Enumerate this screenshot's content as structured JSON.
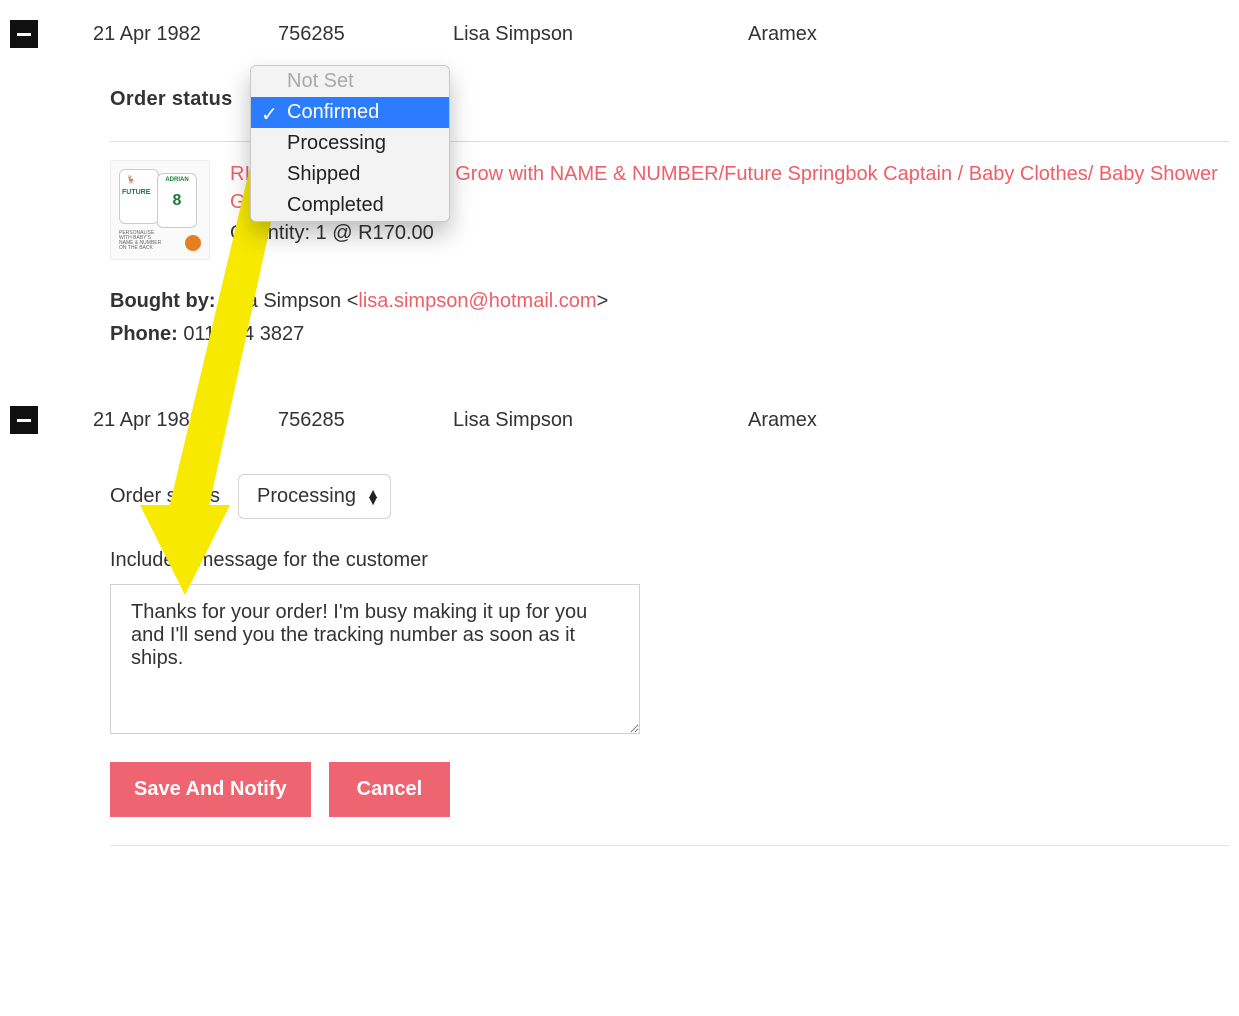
{
  "orders": [
    {
      "date": "21 Apr 1982",
      "order_number": "756285",
      "customer_name": "Lisa Simpson",
      "carrier": "Aramex"
    },
    {
      "date": "21 Apr 1982",
      "order_number": "756285",
      "customer_name": "Lisa Simpson",
      "carrier": "Aramex"
    }
  ],
  "status": {
    "label": "Order status",
    "options": [
      "Not Set",
      "Confirmed",
      "Processing",
      "Shipped",
      "Completed"
    ],
    "selected_top": "Confirmed",
    "selected_bottom": "Processing"
  },
  "item": {
    "title": "SPRINGBOK RUGBY Baby Grow with NAME & NUMBER/Future Springbok Captain / Baby Clothes/ Baby Shower Gift",
    "title_partial": "RINGBOK RUGBY Baby Grow with NAME & NUMBER/Future Springbok Captain / Baby Clothes/ Baby Shower Gift",
    "quantity_line": "Quantity: 1 @ R170.00",
    "thumb_name": "ADRIAN",
    "thumb_number": "8",
    "thumb_word": "FUTURE"
  },
  "buyer": {
    "label": "Bought by:",
    "name": "Lisa Simpson",
    "email": "lisa.simpson@hotmail.com",
    "phone_label": "Phone:",
    "phone": "011 214 3827"
  },
  "message": {
    "label": "Include a message for the customer",
    "value": "Thanks for your order! I'm busy making it up for you and I'll send you the tracking number as soon as it ships."
  },
  "buttons": {
    "save": "Save And Notify",
    "cancel": "Cancel"
  }
}
